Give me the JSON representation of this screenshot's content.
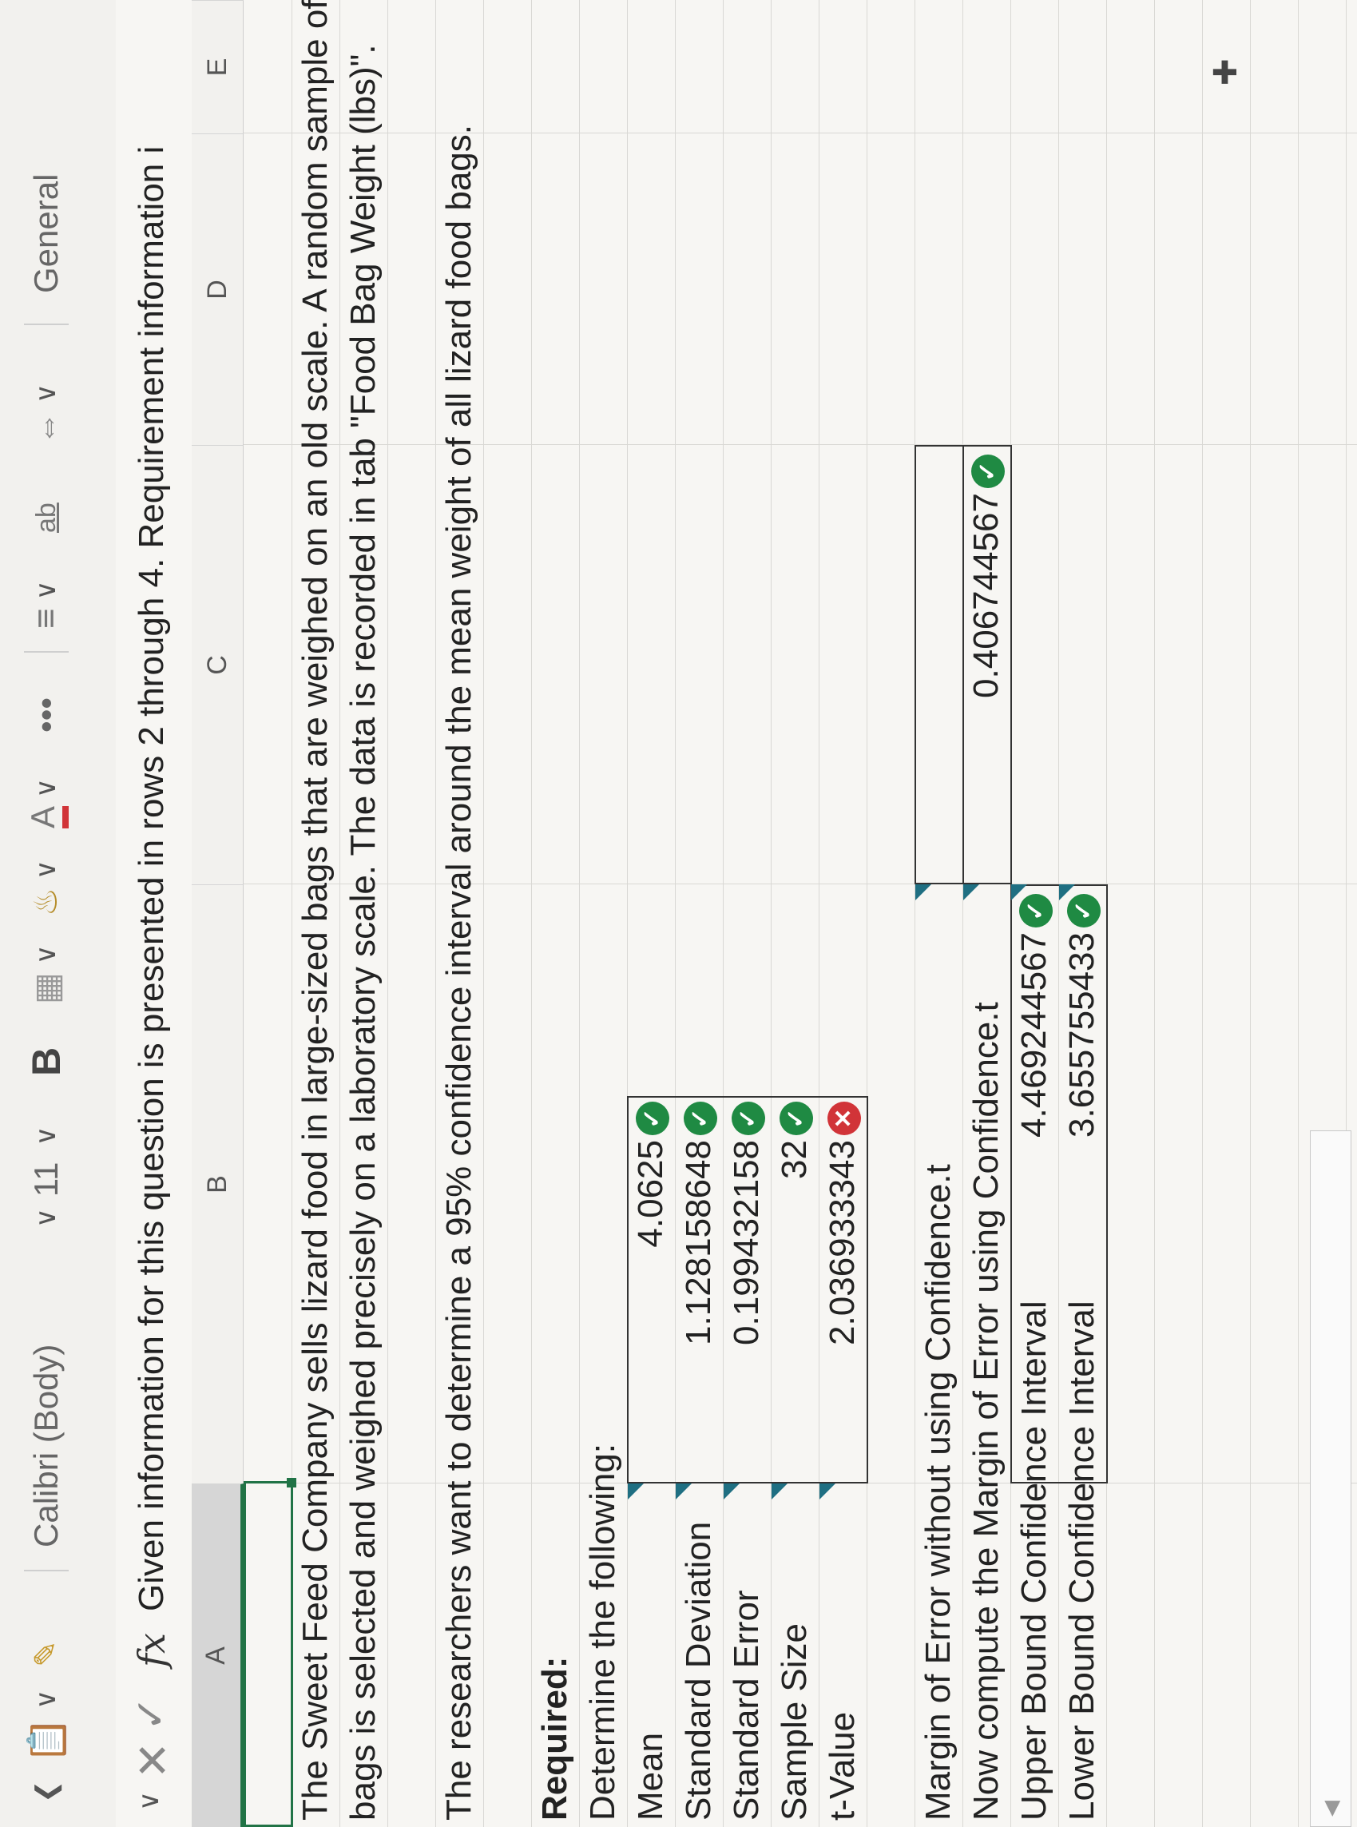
{
  "toolbar": {
    "font_name": "Calibri (Body)",
    "font_size": "11",
    "bold_label": "B",
    "font_color_label": "A",
    "more_label": "•••",
    "wrap_label": "ab",
    "number_format": "General"
  },
  "formula_bar": {
    "fx_label": "fx",
    "content": "Given information for this question is presented in rows 2 through 4. Requirement information i"
  },
  "columns": [
    "A",
    "B",
    "C",
    "D",
    "E"
  ],
  "sheet": {
    "intro_line1": "The Sweet Feed Company sells lizard food in large-sized bags that are weighed on an old scale. A random sample of lizard food",
    "intro_line2": "bags is selected and weighed precisely on a laboratory scale. The data is recorded in tab \"Food Bag Weight (lbs)\".",
    "goal": "The researchers want to determine a 95% confidence interval around the mean weight of all lizard food bags.",
    "required": "Required:",
    "determine": "Determine the following:",
    "stats": [
      {
        "label": "Mean",
        "value": "4.0625",
        "status": "correct"
      },
      {
        "label": "Standard Deviation",
        "value": "1.128158648",
        "status": "correct"
      },
      {
        "label": "Standard Error",
        "value": "0.199432158",
        "status": "correct"
      },
      {
        "label": "Sample Size",
        "value": "32",
        "status": "correct"
      },
      {
        "label": "t-Value",
        "value": "2.036933343",
        "status": "incorrect"
      }
    ],
    "moe_no_conf": "Margin of Error without using Confidence.t",
    "moe_conf_label": "Now compute the Margin of Error using Confidence.t",
    "moe_conf_value": "0.406744567",
    "upper_label": "Upper Bound Confidence Interval",
    "upper_value": "4.469244567",
    "lower_label": "Lower Bound Confidence Interval",
    "lower_value": "3.655755433"
  },
  "colors": {
    "correct": "#1f8a43",
    "incorrect": "#d13438",
    "selection": "#217346"
  }
}
